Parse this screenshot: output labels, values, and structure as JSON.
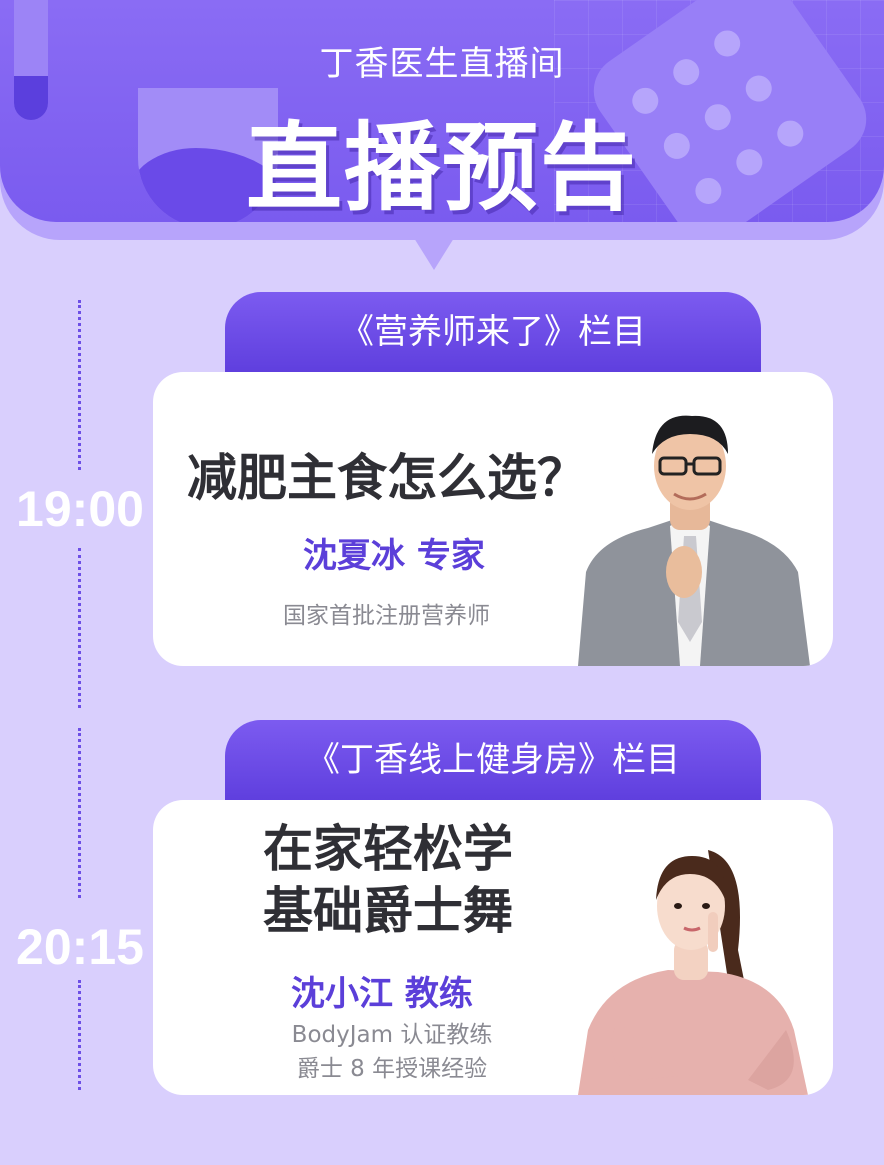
{
  "banner": {
    "subtitle": "丁香医生直播间",
    "title": "直播预告"
  },
  "programs": [
    {
      "time": "19:00",
      "column": "《营养师来了》栏目",
      "title_lines": [
        "减肥主食怎么选？"
      ],
      "host": "沈夏冰 专家",
      "desc_lines": [
        "国家首批注册营养师"
      ]
    },
    {
      "time": "20:15",
      "column": "《丁香线上健身房》栏目",
      "title_lines": [
        "在家轻松学",
        "基础爵士舞"
      ],
      "host": "沈小江 教练",
      "desc_lines": [
        "BodyJam 认证教练",
        "爵士 8 年授课经验"
      ]
    }
  ],
  "colors": {
    "accent": "#6d4fe6",
    "background": "#d9cffd",
    "title_text": "#2f2f35",
    "host_text": "#5b3fd9"
  }
}
